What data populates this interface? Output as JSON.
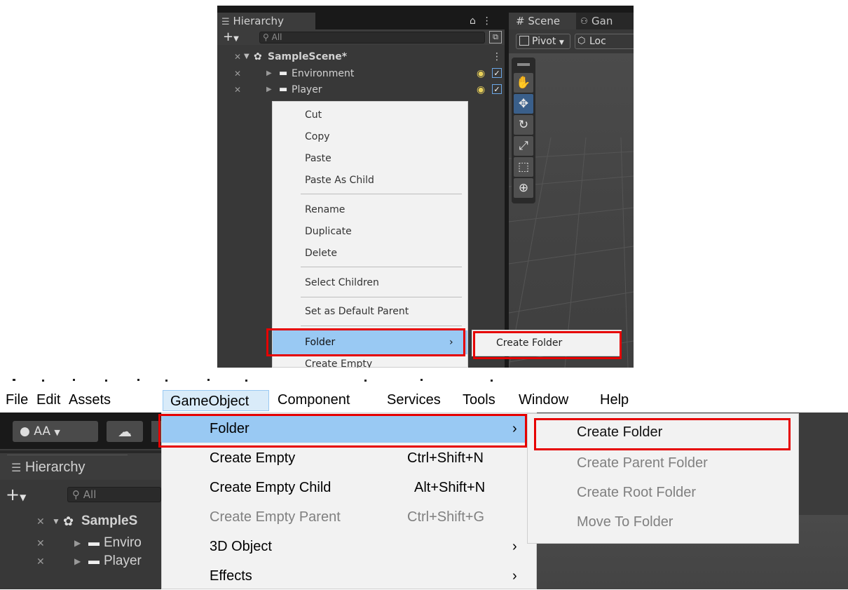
{
  "top": {
    "hierarchy_tab": "Hierarchy",
    "search_placeholder": "All",
    "scene_name": "SampleScene*",
    "objects": [
      "Environment",
      "Player"
    ],
    "scene_tab": "Scene",
    "game_tab": "Gan",
    "pivot_label": "Pivot",
    "local_label": "Loc",
    "context_menu": {
      "group1": [
        "Cut",
        "Copy",
        "Paste",
        "Paste As Child"
      ],
      "group2": [
        "Rename",
        "Duplicate",
        "Delete"
      ],
      "group3": [
        "Select Children"
      ],
      "group4": [
        "Set as Default Parent"
      ],
      "folder": "Folder",
      "create_empty": "Create Empty"
    },
    "submenu_item": "Create Folder"
  },
  "bottom": {
    "menubar": [
      "File",
      "Edit",
      "Assets",
      "GameObject",
      "Component",
      "Services",
      "Tools",
      "Window",
      "Help"
    ],
    "account_label": "AA",
    "hierarchy_tab": "Hierarchy",
    "search_placeholder": "All",
    "scene_name": "SampleS",
    "objects": [
      "Enviro",
      "Player"
    ],
    "dropdown": [
      {
        "label": "Folder",
        "shortcut": "",
        "arrow": "›"
      },
      {
        "label": "Create Empty",
        "shortcut": "Ctrl+Shift+N",
        "arrow": ""
      },
      {
        "label": "Create Empty Child",
        "shortcut": "Alt+Shift+N",
        "arrow": ""
      },
      {
        "label": "Create Empty Parent",
        "shortcut": "Ctrl+Shift+G",
        "arrow": ""
      },
      {
        "label": "3D Object",
        "shortcut": "",
        "arrow": "›"
      },
      {
        "label": "Effects",
        "shortcut": "",
        "arrow": "›"
      }
    ],
    "submenu": [
      "Create Folder",
      "Create Parent Folder",
      "Create Root Folder",
      "Move To Folder"
    ]
  },
  "colors": {
    "highlight": "#99c9f3",
    "annotation_red": "#e60000",
    "disabled_text": "#808080"
  }
}
